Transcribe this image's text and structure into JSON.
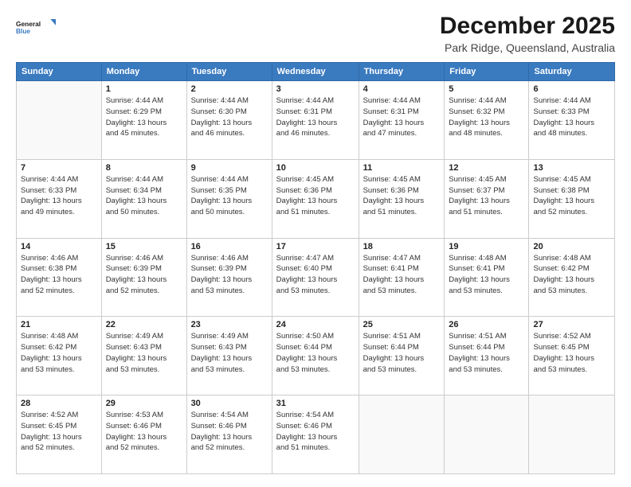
{
  "logo": {
    "line1": "General",
    "line2": "Blue"
  },
  "title": "December 2025",
  "subtitle": "Park Ridge, Queensland, Australia",
  "header_days": [
    "Sunday",
    "Monday",
    "Tuesday",
    "Wednesday",
    "Thursday",
    "Friday",
    "Saturday"
  ],
  "weeks": [
    [
      {
        "day": "",
        "info": ""
      },
      {
        "day": "1",
        "info": "Sunrise: 4:44 AM\nSunset: 6:29 PM\nDaylight: 13 hours\nand 45 minutes."
      },
      {
        "day": "2",
        "info": "Sunrise: 4:44 AM\nSunset: 6:30 PM\nDaylight: 13 hours\nand 46 minutes."
      },
      {
        "day": "3",
        "info": "Sunrise: 4:44 AM\nSunset: 6:31 PM\nDaylight: 13 hours\nand 46 minutes."
      },
      {
        "day": "4",
        "info": "Sunrise: 4:44 AM\nSunset: 6:31 PM\nDaylight: 13 hours\nand 47 minutes."
      },
      {
        "day": "5",
        "info": "Sunrise: 4:44 AM\nSunset: 6:32 PM\nDaylight: 13 hours\nand 48 minutes."
      },
      {
        "day": "6",
        "info": "Sunrise: 4:44 AM\nSunset: 6:33 PM\nDaylight: 13 hours\nand 48 minutes."
      }
    ],
    [
      {
        "day": "7",
        "info": "Sunrise: 4:44 AM\nSunset: 6:33 PM\nDaylight: 13 hours\nand 49 minutes."
      },
      {
        "day": "8",
        "info": "Sunrise: 4:44 AM\nSunset: 6:34 PM\nDaylight: 13 hours\nand 50 minutes."
      },
      {
        "day": "9",
        "info": "Sunrise: 4:44 AM\nSunset: 6:35 PM\nDaylight: 13 hours\nand 50 minutes."
      },
      {
        "day": "10",
        "info": "Sunrise: 4:45 AM\nSunset: 6:36 PM\nDaylight: 13 hours\nand 51 minutes."
      },
      {
        "day": "11",
        "info": "Sunrise: 4:45 AM\nSunset: 6:36 PM\nDaylight: 13 hours\nand 51 minutes."
      },
      {
        "day": "12",
        "info": "Sunrise: 4:45 AM\nSunset: 6:37 PM\nDaylight: 13 hours\nand 51 minutes."
      },
      {
        "day": "13",
        "info": "Sunrise: 4:45 AM\nSunset: 6:38 PM\nDaylight: 13 hours\nand 52 minutes."
      }
    ],
    [
      {
        "day": "14",
        "info": "Sunrise: 4:46 AM\nSunset: 6:38 PM\nDaylight: 13 hours\nand 52 minutes."
      },
      {
        "day": "15",
        "info": "Sunrise: 4:46 AM\nSunset: 6:39 PM\nDaylight: 13 hours\nand 52 minutes."
      },
      {
        "day": "16",
        "info": "Sunrise: 4:46 AM\nSunset: 6:39 PM\nDaylight: 13 hours\nand 53 minutes."
      },
      {
        "day": "17",
        "info": "Sunrise: 4:47 AM\nSunset: 6:40 PM\nDaylight: 13 hours\nand 53 minutes."
      },
      {
        "day": "18",
        "info": "Sunrise: 4:47 AM\nSunset: 6:41 PM\nDaylight: 13 hours\nand 53 minutes."
      },
      {
        "day": "19",
        "info": "Sunrise: 4:48 AM\nSunset: 6:41 PM\nDaylight: 13 hours\nand 53 minutes."
      },
      {
        "day": "20",
        "info": "Sunrise: 4:48 AM\nSunset: 6:42 PM\nDaylight: 13 hours\nand 53 minutes."
      }
    ],
    [
      {
        "day": "21",
        "info": "Sunrise: 4:48 AM\nSunset: 6:42 PM\nDaylight: 13 hours\nand 53 minutes."
      },
      {
        "day": "22",
        "info": "Sunrise: 4:49 AM\nSunset: 6:43 PM\nDaylight: 13 hours\nand 53 minutes."
      },
      {
        "day": "23",
        "info": "Sunrise: 4:49 AM\nSunset: 6:43 PM\nDaylight: 13 hours\nand 53 minutes."
      },
      {
        "day": "24",
        "info": "Sunrise: 4:50 AM\nSunset: 6:44 PM\nDaylight: 13 hours\nand 53 minutes."
      },
      {
        "day": "25",
        "info": "Sunrise: 4:51 AM\nSunset: 6:44 PM\nDaylight: 13 hours\nand 53 minutes."
      },
      {
        "day": "26",
        "info": "Sunrise: 4:51 AM\nSunset: 6:44 PM\nDaylight: 13 hours\nand 53 minutes."
      },
      {
        "day": "27",
        "info": "Sunrise: 4:52 AM\nSunset: 6:45 PM\nDaylight: 13 hours\nand 53 minutes."
      }
    ],
    [
      {
        "day": "28",
        "info": "Sunrise: 4:52 AM\nSunset: 6:45 PM\nDaylight: 13 hours\nand 52 minutes."
      },
      {
        "day": "29",
        "info": "Sunrise: 4:53 AM\nSunset: 6:46 PM\nDaylight: 13 hours\nand 52 minutes."
      },
      {
        "day": "30",
        "info": "Sunrise: 4:54 AM\nSunset: 6:46 PM\nDaylight: 13 hours\nand 52 minutes."
      },
      {
        "day": "31",
        "info": "Sunrise: 4:54 AM\nSunset: 6:46 PM\nDaylight: 13 hours\nand 51 minutes."
      },
      {
        "day": "",
        "info": ""
      },
      {
        "day": "",
        "info": ""
      },
      {
        "day": "",
        "info": ""
      }
    ]
  ]
}
